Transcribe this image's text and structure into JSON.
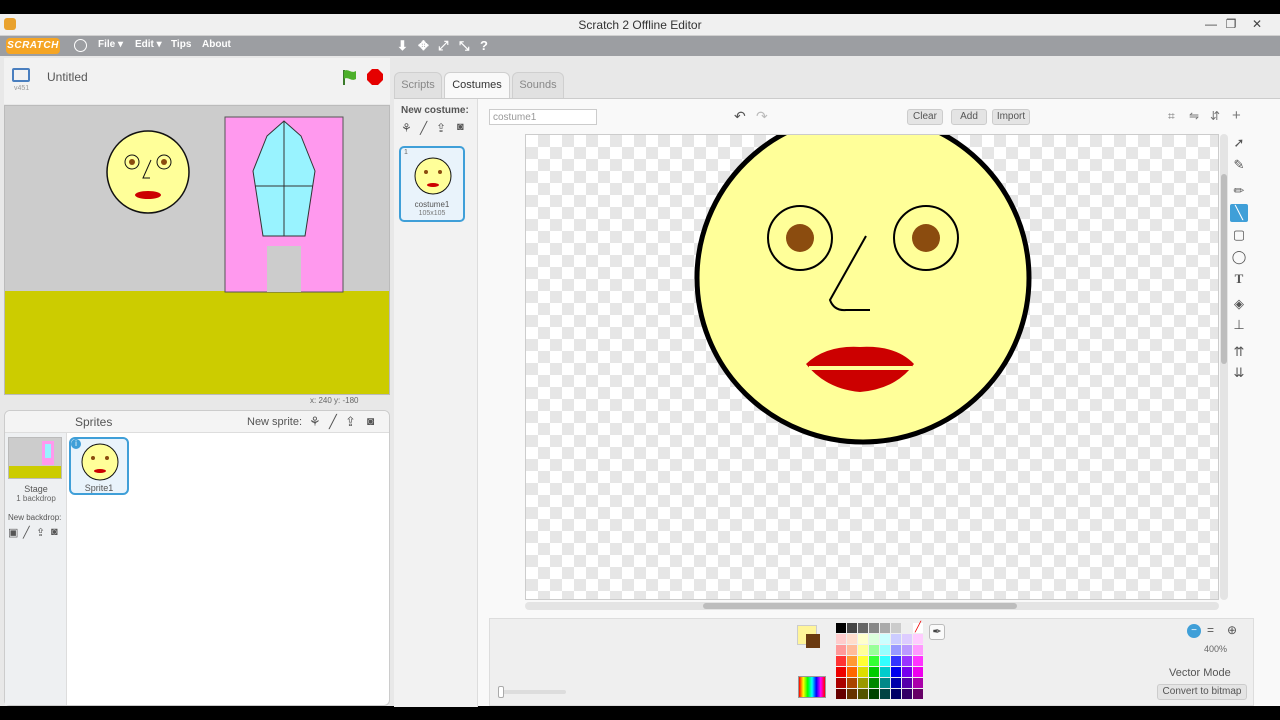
{
  "window": {
    "title": "Scratch 2 Offline Editor",
    "controls": [
      "—",
      "❐",
      "✕"
    ]
  },
  "menubar": {
    "logo": "SCRATCH",
    "items": [
      "File ▾",
      "Edit ▾",
      "Tips",
      "About"
    ]
  },
  "stage": {
    "version": "v451",
    "project_title": "Untitled",
    "coords": "x: 240   y: -180"
  },
  "sprites": {
    "header": "Sprites",
    "new_sprite_label": "New sprite:",
    "stage_label": "Stage",
    "stage_sub": "1 backdrop",
    "new_backdrop_label": "New backdrop:",
    "list": [
      {
        "name": "Sprite1"
      }
    ]
  },
  "tabs": [
    "Scripts",
    "Costumes",
    "Sounds"
  ],
  "costumes": {
    "new_costume_label": "New costume:",
    "items": [
      {
        "index": "1",
        "name": "costume1",
        "size": "105x105"
      }
    ]
  },
  "paint": {
    "costume_name": "costume1",
    "clear_label": "Clear",
    "add_label": "Add",
    "import_label": "Import",
    "zoom_level": "400%",
    "mode_label": "Vector Mode",
    "convert_label": "Convert to bitmap",
    "fill_color": "#fff59a",
    "second_color": "#6b3a10"
  },
  "colors": {
    "face": "#ffff99",
    "eye": "#8b4c0f",
    "lips": "#cc0000",
    "curtain": "#ff99ee",
    "window": "#99f3ff",
    "floor": "#cccc00",
    "wall": "#cccccc",
    "selected_tool": "#3f9fd8"
  }
}
